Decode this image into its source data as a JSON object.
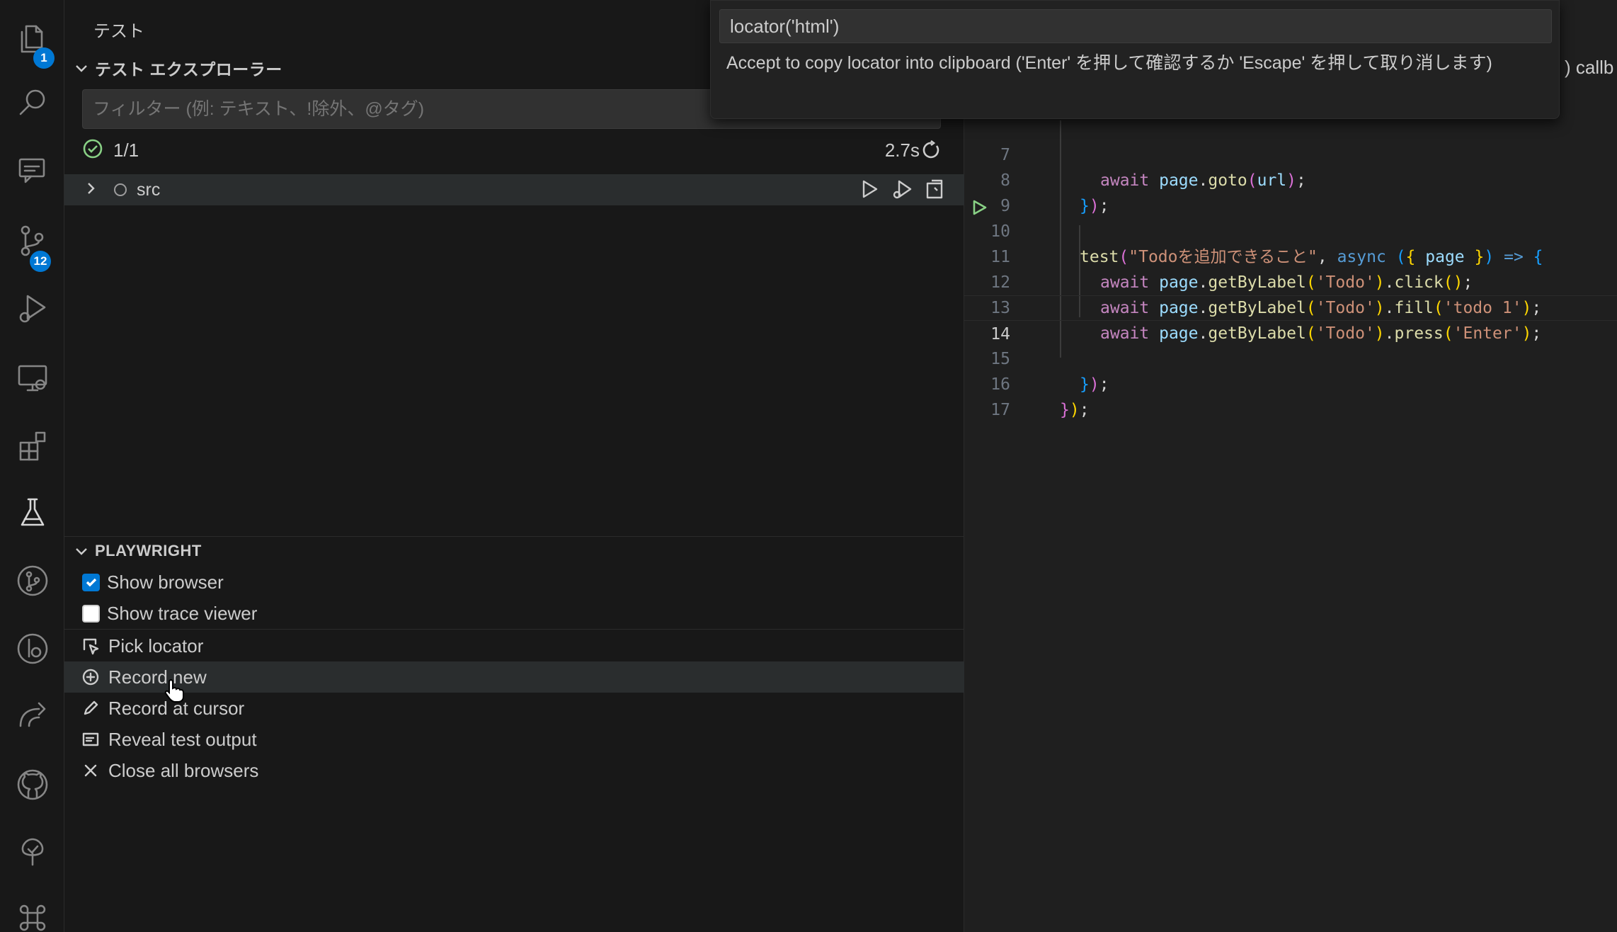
{
  "activity_bar": {
    "explorer_badge": "1",
    "source_control_badge": "12"
  },
  "sidebar": {
    "title": "テスト",
    "test_explorer": {
      "header": "テスト エクスプローラー",
      "filter_placeholder": "フィルター (例: テキスト、!除外、@タグ)",
      "summary_count": "1/1",
      "duration": "2.7s",
      "items": [
        {
          "label": "src"
        }
      ]
    },
    "playwright": {
      "header": "PLAYWRIGHT",
      "show_browser": {
        "label": "Show browser",
        "checked": true
      },
      "show_trace_viewer": {
        "label": "Show trace viewer",
        "checked": false
      },
      "pick_locator": "Pick locator",
      "record_new": "Record new",
      "record_at_cursor": "Record at cursor",
      "reveal_test_output": "Reveal test output",
      "close_all_browsers": "Close all browsers"
    }
  },
  "quick_pick": {
    "input_value": "locator('html')",
    "message": "Accept to copy locator into clipboard ('Enter' を押して確認するか 'Escape' を押して取り消します)"
  },
  "editor": {
    "behind_text": ") callb",
    "current_line": 14,
    "line_numbers": [
      "7",
      "8",
      "9",
      "10",
      "11",
      "12",
      "13",
      "14",
      "15",
      "16",
      "17"
    ],
    "code": {
      "l7_await": "await",
      "l7_page": "page",
      "l7_goto": "goto",
      "l7_url": "url",
      "l10_test": "test",
      "l10_title": "\"Todoを追加できること\"",
      "l10_async": "async",
      "l10_page": "page",
      "l10_arrow": "=>",
      "await": "await",
      "page": "page",
      "getByLabel": "getByLabel",
      "todo_arg": "'Todo'",
      "click": "click",
      "fill": "fill",
      "fill_arg": "'todo 1'",
      "press": "press",
      "press_arg": "'Enter'"
    }
  },
  "colors": {
    "accent": "#0078d4",
    "passed": "#89d185"
  }
}
